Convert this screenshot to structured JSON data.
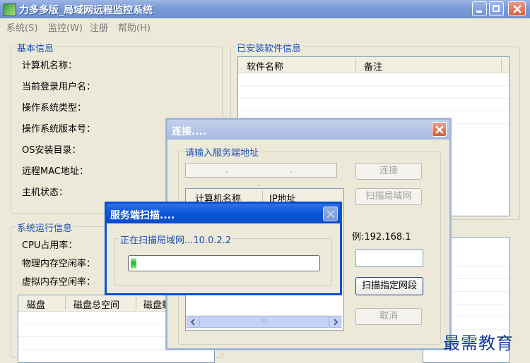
{
  "window": {
    "title": "力多多版_局域网远程监控系统",
    "menu": [
      "系统(S)",
      "监控(W)",
      "注册",
      "帮助(H)"
    ]
  },
  "basic_info": {
    "title": "基本信息",
    "fields": [
      "计算机名称：",
      "当前登录用户名：",
      "操作系统类型：",
      "操作系统版本号：",
      "OS安装目录：",
      "远程MAC地址：",
      "主机状态："
    ]
  },
  "software_info": {
    "title": "已安装软件信息",
    "columns": [
      "软件名称",
      "备注"
    ]
  },
  "runtime_info": {
    "title": "系统运行信息",
    "fields": [
      "CPU占用率：",
      "物理内存空闲率：",
      "虚拟内存空闲率："
    ],
    "disk_columns": [
      "磁盘",
      "磁盘总空间",
      "磁盘剩"
    ]
  },
  "connect_dialog": {
    "title": "连接....",
    "group_title": "请输入服务端地址",
    "ip_placeholder": ". . .",
    "connect_button": "连接",
    "scan_lan_button": "扫描局域网",
    "columns": [
      "计算机名称",
      "IP地址"
    ],
    "example_text": "例:192.168.1",
    "scan_segment_button": "扫描指定网段",
    "cancel_button": "取消",
    "scroll_thumb": "III"
  },
  "scan_dialog": {
    "title": "服务端扫描....",
    "status": "正在扫描局域网...10.0.2.2",
    "progress": 0.03
  },
  "watermark": "最需教育",
  "colors": {
    "accent": "#0a4fd6",
    "group_title": "#1b4fbf",
    "progress": "#2ec32e"
  }
}
